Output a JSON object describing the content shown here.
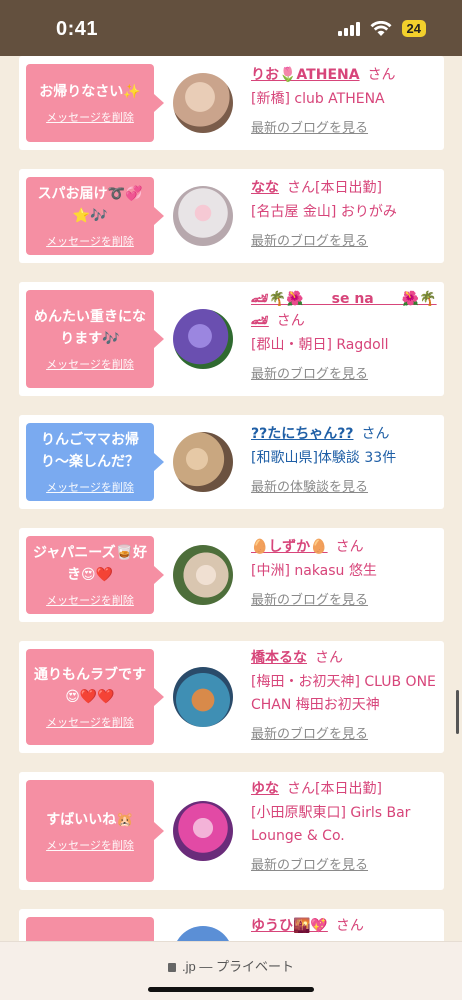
{
  "status_bar": {
    "time": "0:41",
    "battery": "24"
  },
  "delete_label": "メッセージを削除",
  "san": "さん",
  "cards": [
    {
      "message": "お帰りなさい✨",
      "bubble_color": "pink",
      "name": "りお🌷ATHENA",
      "status_tag": "",
      "shop": "[新橋] club ATHENA",
      "latest": "最新のブログを見る",
      "avatar_colors": [
        "#caa48c",
        "#7a5c4a"
      ]
    },
    {
      "message": "スパお届け➰💞⭐️🎶",
      "bubble_color": "pink",
      "name": "なな",
      "status_tag": "[本日出勤]",
      "shop": "[名古屋 金山] おりがみ",
      "latest": "最新のブログを見る",
      "avatar_colors": [
        "#e8e4e6",
        "#b7a8ad"
      ]
    },
    {
      "message": "めんたい重きになります🎶",
      "bubble_color": "pink",
      "name": "🏎🌴🌺　　se na　　🌺🌴🏎",
      "status_tag": "",
      "shop": "[郡山・朝日] Ragdoll",
      "latest": "最新のブログを見る",
      "avatar_colors": [
        "#6a4fb0",
        "#2f6a30"
      ]
    },
    {
      "message": "りんごママお帰り〜楽しんだ？",
      "bubble_color": "blue",
      "name": "??たにちゃん??",
      "status_tag": "",
      "shop": "[和歌山県]体験談 33件",
      "latest": "最新の体験談を見る",
      "avatar_colors": [
        "#c9a780",
        "#6b5240"
      ]
    },
    {
      "message": "ジャパニーズ🥃好き😍❤️",
      "bubble_color": "pink",
      "name": "🥚しずか🥚",
      "status_tag": "",
      "shop": "[中洲] nakasu 悠生",
      "latest": "最新のブログを見る",
      "avatar_colors": [
        "#d9c6b0",
        "#4d6e3a"
      ]
    },
    {
      "message": "通りもんラブです😍❤️❤️",
      "bubble_color": "pink",
      "name": "橋本るな",
      "status_tag": "",
      "shop": "[梅田・お初天神] CLUB ONE CHAN 梅田お初天神",
      "latest": "最新のブログを見る",
      "avatar_colors": [
        "#3f8fb4",
        "#d88a4a"
      ]
    },
    {
      "message": "すばいいね🐹",
      "bubble_color": "pink",
      "name": "ゆな",
      "status_tag": "[本日出勤]",
      "shop": "[小田原駅東口] Girls Bar Lounge & Co.",
      "latest": "最新のブログを見る",
      "avatar_colors": [
        "#e24aa5",
        "#6a2c7a"
      ]
    },
    {
      "message": "😻💖",
      "bubble_color": "pink",
      "name": "ゆうひ🌇💖",
      "status_tag": "",
      "shop": "",
      "latest": "",
      "avatar_colors": [
        "#5b8fd6",
        "#f1b07a"
      ]
    }
  ],
  "browser": {
    "url": ".jp — プライベート"
  }
}
